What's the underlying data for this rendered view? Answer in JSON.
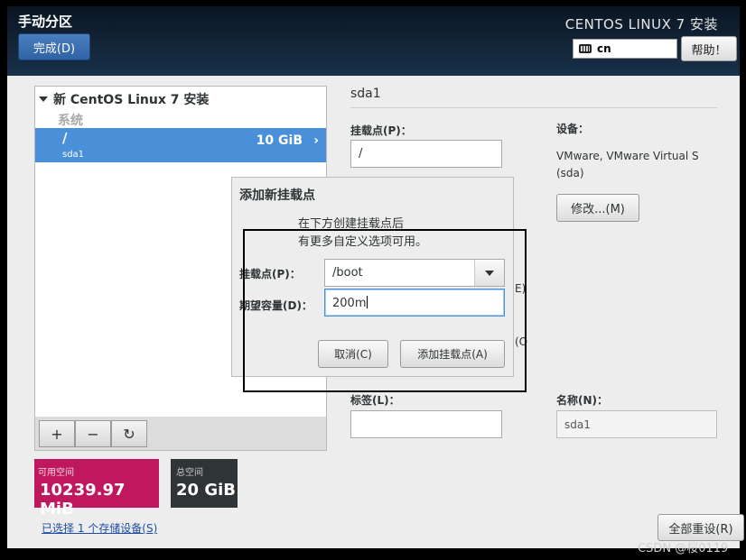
{
  "header": {
    "title": "手动分区",
    "done_button": "完成(D)",
    "product": "CENTOS LINUX 7 安装",
    "keyboard_layout": "cn",
    "help_button": "帮助！",
    "keyboard_icon": "keyboard-icon"
  },
  "left_panel": {
    "install_header": "新 CentOS Linux 7 安装",
    "system_label": "系统",
    "selected_row": {
      "mount_point": "/",
      "device": "sda1",
      "size": "10 GiB",
      "chevron": "›"
    },
    "toolbar": {
      "add": "+",
      "remove": "−",
      "refresh": "↻"
    },
    "available": {
      "label": "可用空间",
      "value": "10239.97 MiB"
    },
    "total": {
      "label": "总空间",
      "value": "20 GiB"
    },
    "storage_link": "已选择 1 个存储设备(S)"
  },
  "right_panel": {
    "title": "sda1",
    "mount_point_label": "挂载点(P)：",
    "mount_point_value": "/",
    "device_label": "设备：",
    "device_name": "VMware, VMware Virtual S",
    "device_sda": "(sda)",
    "modify_button": "修改...(M)",
    "fragment_e": "E)",
    "fragment_o": "(O",
    "tag_label": "标签(L)：",
    "name_label": "名称(N)：",
    "name_value": "sda1",
    "reset_button": "全部重设(R)"
  },
  "dialog": {
    "title": "添加新挂载点",
    "desc_line1": "在下方创建挂载点后",
    "desc_line2": "有更多自定义选项可用。",
    "mount_point_label": "挂载点(P)：",
    "mount_point_value": "/boot",
    "capacity_label": "期望容量(D)：",
    "capacity_value": "200m",
    "cancel_button": "取消(C)",
    "add_button": "添加挂载点(A)"
  },
  "colors": {
    "selection_blue": "#4a90d9",
    "available_magenta": "#c0185f",
    "total_dark": "#2f3436",
    "header_dark": "#132538"
  },
  "watermark": "CSDN @桜0119"
}
